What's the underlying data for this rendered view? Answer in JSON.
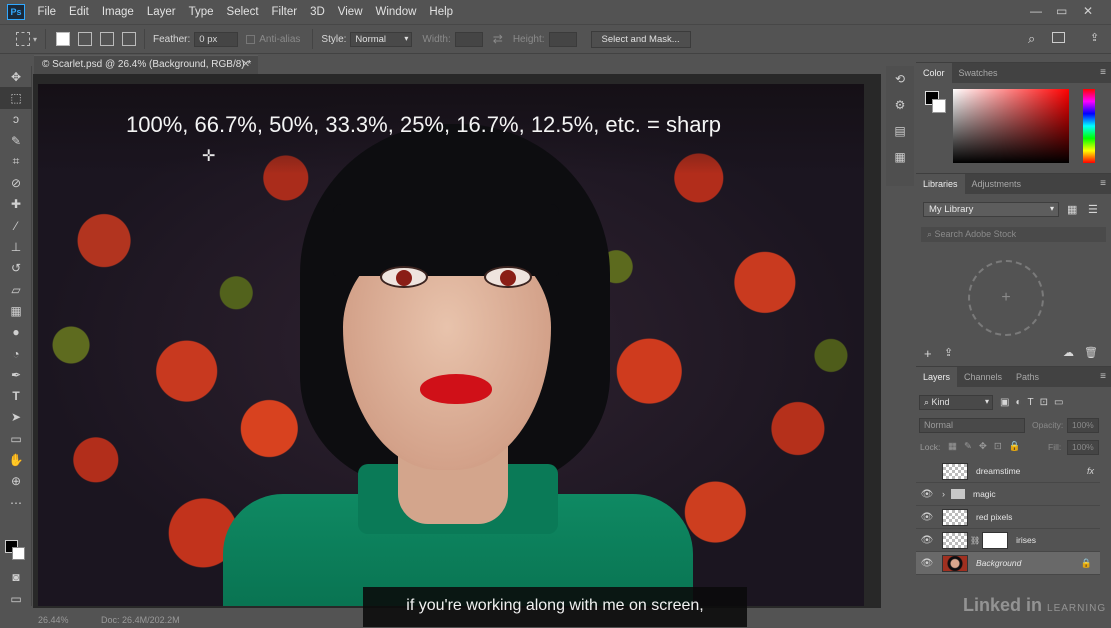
{
  "app": {
    "logo": "Ps"
  },
  "menu": [
    "File",
    "Edit",
    "Image",
    "Layer",
    "Type",
    "Select",
    "Filter",
    "3D",
    "View",
    "Window",
    "Help"
  ],
  "window_controls": {
    "minimize": "—",
    "restore": "▭",
    "close": "✕"
  },
  "options": {
    "feather_label": "Feather:",
    "feather_value": "0 px",
    "antialias_label": "Anti-alias",
    "style_label": "Style:",
    "style_value": "Normal",
    "width_label": "Width:",
    "height_label": "Height:",
    "select_mask_label": "Select and Mask..."
  },
  "document": {
    "tab_title": "© Scarlet.psd @ 26.4% (Background, RGB/8) *",
    "overlay_text": "100%, 66.7%, 50%, 33.3%, 25%, 16.7%, 12.5%, etc. = sharp"
  },
  "status": {
    "zoom": "26.44%",
    "doc": "Doc: 26.4M/202.2M"
  },
  "caption": "if you're working along with me on screen,",
  "watermark": {
    "brand": "Linked in",
    "sub": "LEARNING"
  },
  "color_panel": {
    "tabs": [
      "Color",
      "Swatches"
    ]
  },
  "libraries_panel": {
    "tabs": [
      "Libraries",
      "Adjustments"
    ],
    "library_name": "My Library",
    "search_placeholder": "Search Adobe Stock"
  },
  "layers_panel": {
    "tabs": [
      "Layers",
      "Channels",
      "Paths"
    ],
    "filter_label": "Kind",
    "blend_mode": "Normal",
    "opacity_label": "Opacity:",
    "opacity_value": "100%",
    "lock_label": "Lock:",
    "fill_label": "Fill:",
    "fill_value": "100%",
    "layers": [
      {
        "name": "dreamstime",
        "visible": false,
        "fx": "fx"
      },
      {
        "name": "magic",
        "visible": true,
        "group": true
      },
      {
        "name": "red pixels",
        "visible": true
      },
      {
        "name": "irises",
        "visible": true,
        "mask": true
      },
      {
        "name": "Background",
        "visible": true,
        "selected": true,
        "locked": true
      }
    ]
  },
  "colors": {
    "ui_bg": "#535353",
    "panel_dark": "#424242",
    "canvas_bg": "#282828",
    "accent_ps": "#31a8ff",
    "lipstick": "#d01018",
    "shirt": "#0f8a63"
  }
}
